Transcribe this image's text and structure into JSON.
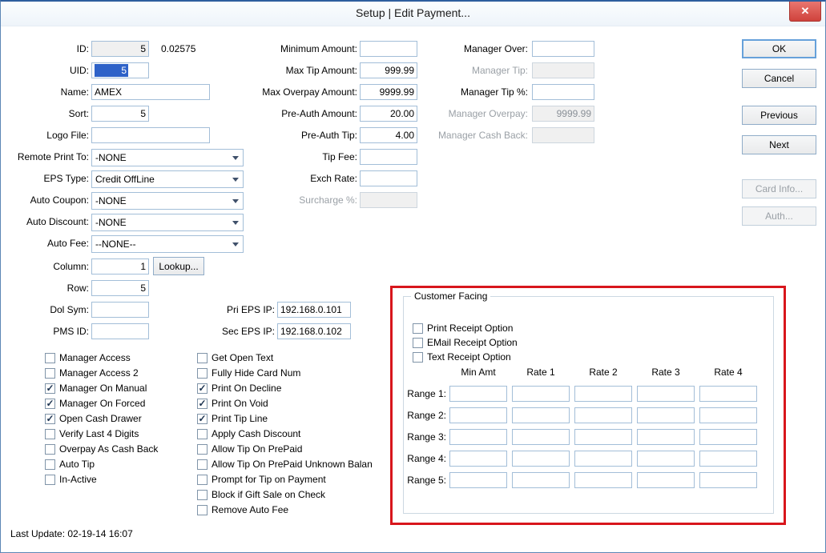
{
  "window": {
    "title": "Setup | Edit Payment...",
    "close_icon": "✕"
  },
  "left": {
    "id": {
      "label": "ID:",
      "value": "5"
    },
    "id_extra": "0.02575",
    "uid": {
      "label": "UID:",
      "value": "5"
    },
    "name": {
      "label": "Name:",
      "value": "AMEX"
    },
    "sort": {
      "label": "Sort:",
      "value": "5"
    },
    "logo_file": {
      "label": "Logo File:",
      "value": ""
    },
    "remote_print_to": {
      "label": "Remote Print To:",
      "value": "-NONE"
    },
    "eps_type": {
      "label": "EPS Type:",
      "value": "Credit OffLine"
    },
    "auto_coupon": {
      "label": "Auto Coupon:",
      "value": "-NONE"
    },
    "auto_discount": {
      "label": "Auto Discount:",
      "value": "-NONE"
    },
    "auto_fee": {
      "label": "Auto Fee:",
      "value": "--NONE--"
    },
    "column": {
      "label": "Column:",
      "value": "1"
    },
    "lookup_button": "Lookup...",
    "row": {
      "label": "Row:",
      "value": "5"
    },
    "dol_sym": {
      "label": "Dol Sym:",
      "value": ""
    },
    "pms_id": {
      "label": "PMS ID:",
      "value": ""
    }
  },
  "middle": {
    "minimum_amount": {
      "label": "Minimum Amount:",
      "value": ""
    },
    "max_tip_amount": {
      "label": "Max Tip Amount:",
      "value": "999.99"
    },
    "max_overpay_amount": {
      "label": "Max Overpay Amount:",
      "value": "9999.99"
    },
    "pre_auth_amount": {
      "label": "Pre-Auth Amount:",
      "value": "20.00"
    },
    "pre_auth_tip": {
      "label": "Pre-Auth Tip:",
      "value": "4.00"
    },
    "tip_fee": {
      "label": "Tip Fee:",
      "value": ""
    },
    "exch_rate": {
      "label": "Exch Rate:",
      "value": ""
    },
    "surcharge": {
      "label": "Surcharge %:",
      "value": ""
    },
    "pri_eps_ip": {
      "label": "Pri EPS IP:",
      "value": "192.168.0.101"
    },
    "sec_eps_ip": {
      "label": "Sec EPS IP:",
      "value": "192.168.0.102"
    }
  },
  "manager": {
    "manager_over": {
      "label": "Manager Over:",
      "value": ""
    },
    "manager_tip": {
      "label": "Manager Tip:",
      "value": ""
    },
    "manager_tip_pct": {
      "label": "Manager Tip %:",
      "value": ""
    },
    "manager_overpay": {
      "label": "Manager Overpay:",
      "value": "9999.99"
    },
    "manager_cash_back": {
      "label": "Manager Cash Back:",
      "value": ""
    }
  },
  "buttons": {
    "ok": "OK",
    "cancel": "Cancel",
    "previous": "Previous",
    "next": "Next",
    "card_info": "Card Info...",
    "auth": "Auth..."
  },
  "checks_left": [
    {
      "label": "Manager Access",
      "mark": ""
    },
    {
      "label": "Manager Access 2",
      "mark": ""
    },
    {
      "label": "Manager On Manual",
      "mark": "✓"
    },
    {
      "label": "Manager On Forced",
      "mark": "✓"
    },
    {
      "label": "Open Cash Drawer",
      "mark": "✓"
    },
    {
      "label": "Verify Last 4 Digits",
      "mark": ""
    },
    {
      "label": "Overpay As Cash Back",
      "mark": ""
    },
    {
      "label": "Auto Tip",
      "mark": ""
    },
    {
      "label": "In-Active",
      "mark": ""
    }
  ],
  "checks_middle": [
    {
      "label": "Get Open Text",
      "mark": ""
    },
    {
      "label": "Fully Hide Card Num",
      "mark": ""
    },
    {
      "label": "Print On Decline",
      "mark": "✓"
    },
    {
      "label": "Print On Void",
      "mark": "✓"
    },
    {
      "label": "Print Tip Line",
      "mark": "✓"
    },
    {
      "label": "Apply Cash Discount",
      "mark": ""
    },
    {
      "label": "Allow Tip On PrePaid",
      "mark": ""
    },
    {
      "label": "Allow Tip On PrePaid Unknown Balan",
      "mark": ""
    },
    {
      "label": "Prompt for Tip on Payment",
      "mark": ""
    },
    {
      "label": "Block if Gift Sale on Check",
      "mark": ""
    },
    {
      "label": "Remove Auto Fee",
      "mark": ""
    }
  ],
  "customer_facing": {
    "title": "Customer Facing",
    "checks": [
      {
        "label": "Print Receipt Option",
        "mark": ""
      },
      {
        "label": "EMail Receipt Option",
        "mark": ""
      },
      {
        "label": "Text Receipt Option",
        "mark": ""
      }
    ],
    "col_headers": [
      "Min Amt",
      "Rate 1",
      "Rate 2",
      "Rate 3",
      "Rate 4"
    ],
    "row_labels": [
      "Range 1:",
      "Range 2:",
      "Range 3:",
      "Range 4:",
      "Range 5:"
    ]
  },
  "footer": {
    "last_update": "Last Update: 02-19-14 16:07"
  },
  "colors": {
    "annotation_red": "#d8161c",
    "selection_blue": "#2e62c8",
    "close_red": "#cf423c"
  }
}
